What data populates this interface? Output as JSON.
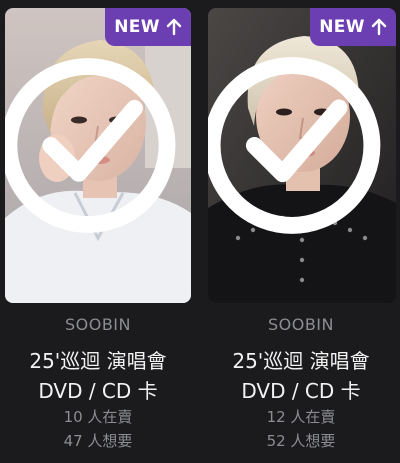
{
  "cards": [
    {
      "badge": "NEW",
      "member": "SOOBIN",
      "title_line1": "25'巡迴 演唱會",
      "title_line2": "DVD / CD 卡",
      "selling": "10 人在賣",
      "wanting": "47 人想要"
    },
    {
      "badge": "NEW",
      "member": "SOOBIN",
      "title_line1": "25'巡迴 演唱會",
      "title_line2": "DVD / CD 卡",
      "selling": "12 人在賣",
      "wanting": "52 人想要"
    }
  ],
  "colors": {
    "background": "#1b1b1d",
    "badge": "#6b3fb1",
    "muted_text": "#8b8d93",
    "title_text": "#f2f2f2"
  },
  "icons": {
    "badge_arrow": "arrow-up-icon",
    "owned_check": "check-circle-icon"
  }
}
